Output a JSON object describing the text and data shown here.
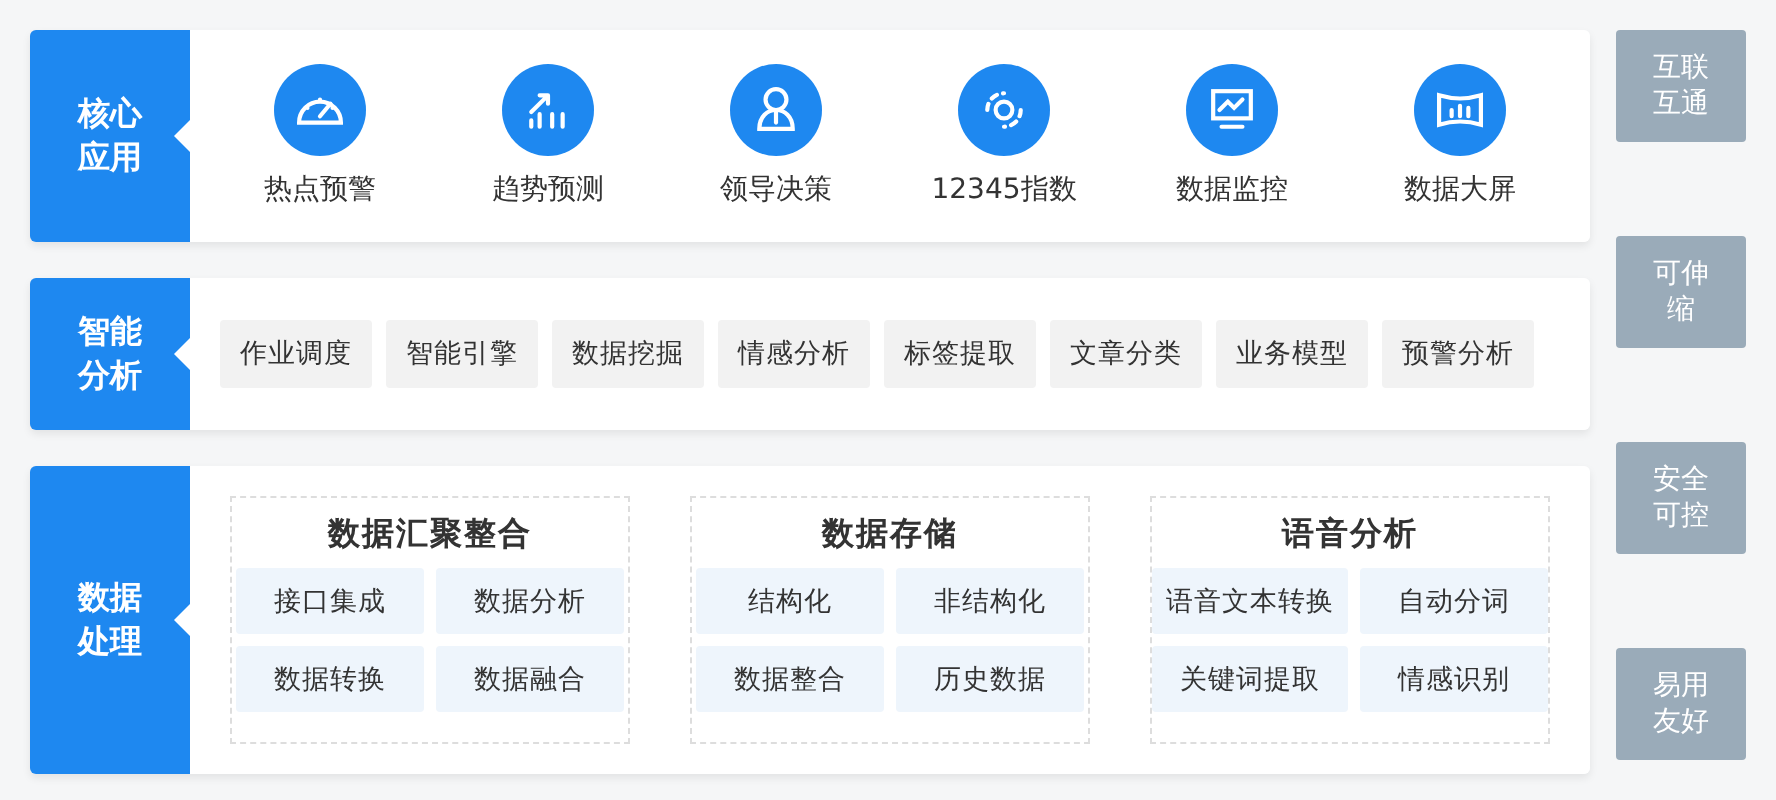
{
  "core_apps": {
    "label": "核心应用",
    "items": [
      {
        "label": "热点预警"
      },
      {
        "label": "趋势预测"
      },
      {
        "label": "领导决策"
      },
      {
        "label": "12345指数"
      },
      {
        "label": "数据监控"
      },
      {
        "label": "数据大屏"
      }
    ]
  },
  "smart_analysis": {
    "label": "智能分析",
    "tags": [
      "作业调度",
      "智能引擎",
      "数据挖掘",
      "情感分析",
      "标签提取",
      "文章分类",
      "业务模型",
      "预警分析"
    ]
  },
  "data_processing": {
    "label": "数据处理",
    "groups": [
      {
        "title": "数据汇聚整合",
        "tags": [
          "接口集成",
          "数据分析",
          "数据转换",
          "数据融合"
        ]
      },
      {
        "title": "数据存储",
        "tags": [
          "结构化",
          "非结构化",
          "数据整合",
          "历史数据"
        ]
      },
      {
        "title": "语音分析",
        "tags": [
          "语音文本转换",
          "自动分词",
          "关键词提取",
          "情感识别"
        ]
      }
    ]
  },
  "side_badges": [
    "互联互通",
    "可伸缩",
    "安全可控",
    "易用友好"
  ]
}
